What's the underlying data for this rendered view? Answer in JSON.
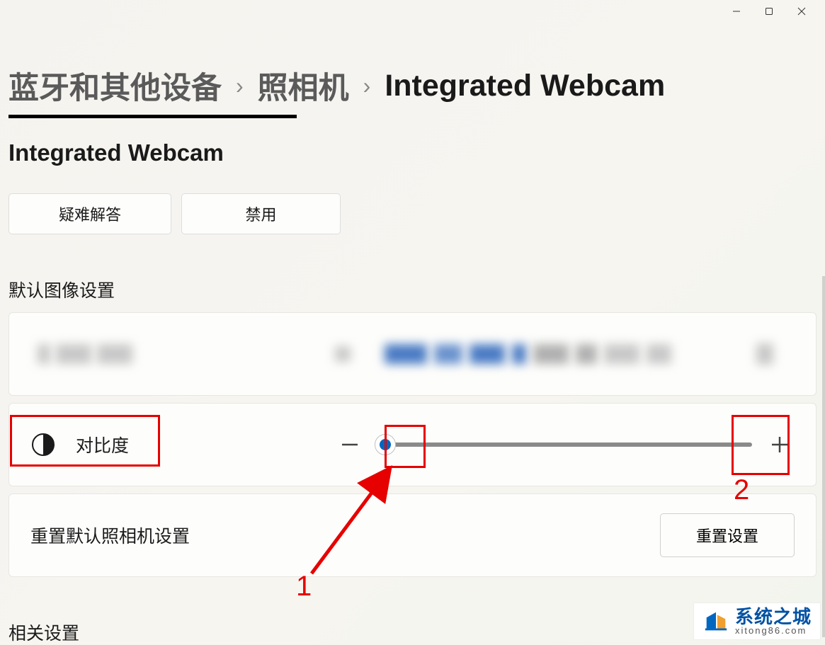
{
  "titlebar": {
    "minimize": "minimize",
    "maximize": "maximize",
    "close": "close"
  },
  "breadcrumb": {
    "level1": "蓝牙和其他设备",
    "level2": "照相机",
    "level3": "Integrated Webcam"
  },
  "device": {
    "name": "Integrated Webcam"
  },
  "buttons": {
    "troubleshoot": "疑难解答",
    "disable": "禁用"
  },
  "sections": {
    "default_image": "默认图像设置",
    "related": "相关设置"
  },
  "contrast": {
    "label": "对比度"
  },
  "reset": {
    "label": "重置默认照相机设置",
    "button": "重置设置"
  },
  "annotations": {
    "marker1": "1",
    "marker2": "2"
  },
  "watermark": {
    "main": "系统之城",
    "sub": "xitong86.com"
  }
}
